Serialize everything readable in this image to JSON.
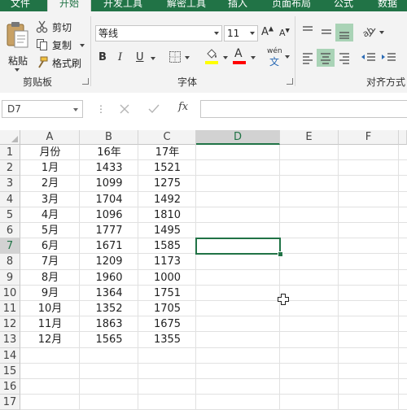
{
  "ribbon_tabs": [
    {
      "label": "文件"
    },
    {
      "label": "开始"
    },
    {
      "label": "开发工具"
    },
    {
      "label": "解密工具"
    },
    {
      "label": "插入"
    },
    {
      "label": "页面布局"
    },
    {
      "label": "公式"
    },
    {
      "label": "数据"
    }
  ],
  "clipboard": {
    "paste_label": "粘贴",
    "cut_label": "剪切",
    "copy_label": "复制",
    "format_painter_label": "格式刷",
    "group_label": "剪贴板"
  },
  "font": {
    "font_name": "等线",
    "font_size": "11",
    "bold": "B",
    "italic": "I",
    "underline": "U",
    "highlight_color": "#ffff00",
    "font_color": "#ff0000",
    "phonetic_label": "wén",
    "group_label": "字体"
  },
  "alignment": {
    "group_label": "对齐方式"
  },
  "formula_bar": {
    "name_box": "D7",
    "fx_label": "fx",
    "formula": ""
  },
  "colors": {
    "accent": "#217346"
  },
  "columns": [
    "A",
    "B",
    "C",
    "D",
    "E",
    "F"
  ],
  "row_numbers": [
    "1",
    "2",
    "3",
    "4",
    "5",
    "6",
    "7",
    "8",
    "9",
    "10",
    "11",
    "12",
    "13",
    "14",
    "15",
    "16",
    "17"
  ],
  "selected_cell": "D7",
  "table": {
    "header": [
      "月份",
      "16年",
      "17年"
    ],
    "rows": [
      [
        "1月",
        "1433",
        "1521"
      ],
      [
        "2月",
        "1099",
        "1275"
      ],
      [
        "3月",
        "1704",
        "1492"
      ],
      [
        "4月",
        "1096",
        "1810"
      ],
      [
        "5月",
        "1777",
        "1495"
      ],
      [
        "6月",
        "1671",
        "1585"
      ],
      [
        "7月",
        "1209",
        "1173"
      ],
      [
        "8月",
        "1960",
        "1000"
      ],
      [
        "9月",
        "1364",
        "1751"
      ],
      [
        "10月",
        "1352",
        "1705"
      ],
      [
        "11月",
        "1863",
        "1675"
      ],
      [
        "12月",
        "1565",
        "1355"
      ]
    ]
  }
}
